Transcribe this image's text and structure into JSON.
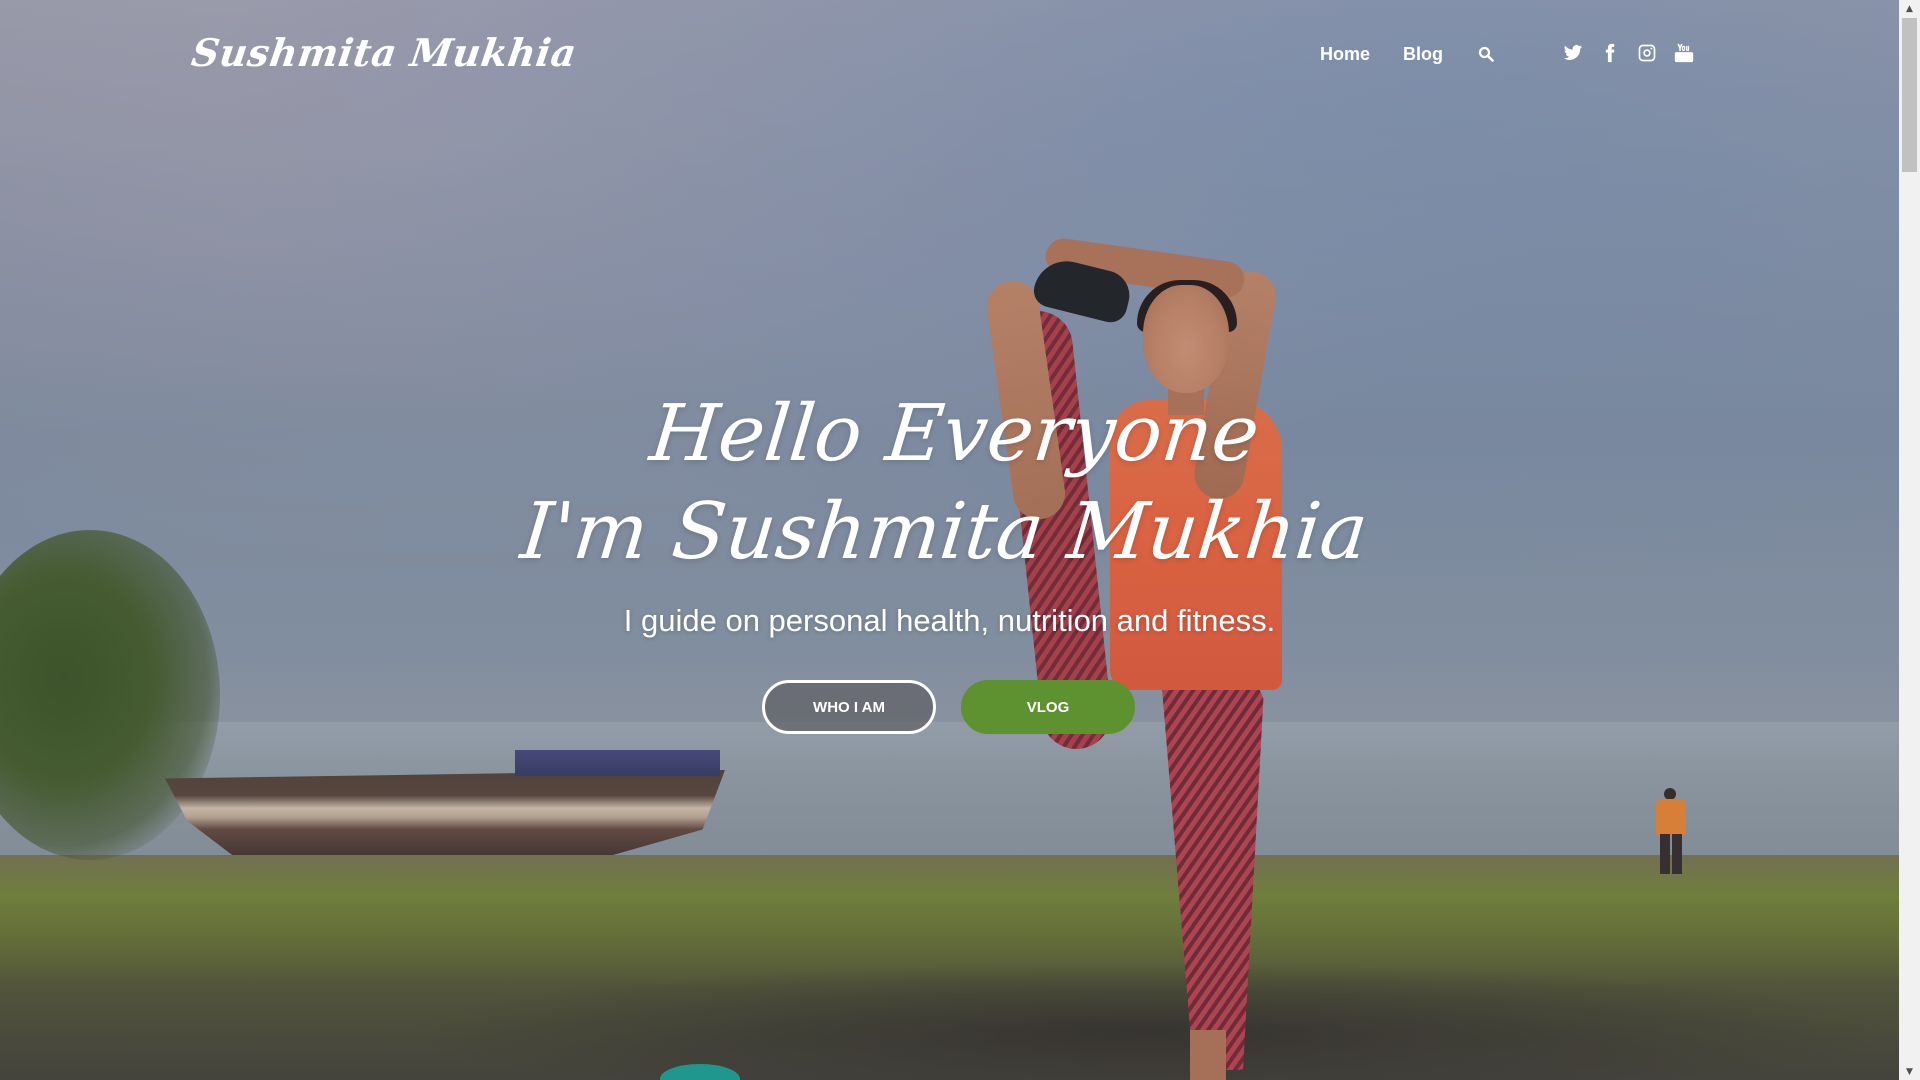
{
  "header": {
    "logo_text": "Sushmita Mukhia",
    "nav": [
      {
        "label": "Home"
      },
      {
        "label": "Blog"
      }
    ],
    "social_icons": [
      "twitter-icon",
      "facebook-icon",
      "instagram-icon",
      "youtube-icon"
    ]
  },
  "hero": {
    "title_line1": "Hello Everyone",
    "title_line2": "I'm Sushmita Mukhia",
    "subtitle": "I guide on personal health, nutrition and fitness.",
    "buttons": [
      {
        "label": "WHO I AM"
      },
      {
        "label": "VLOG"
      }
    ]
  },
  "colors": {
    "accent_green": "#5e9130",
    "text": "#ffffff"
  }
}
